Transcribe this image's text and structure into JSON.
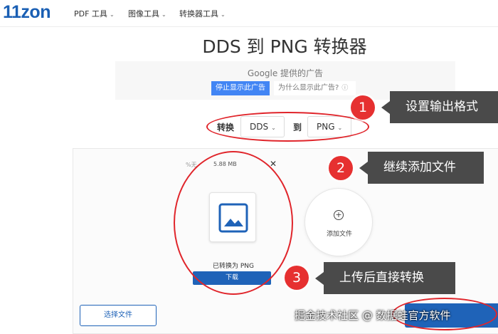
{
  "header": {
    "logo": "11zon",
    "nav": [
      {
        "label": "PDF 工具"
      },
      {
        "label": "图像工具"
      },
      {
        "label": "转换器工具"
      }
    ]
  },
  "page": {
    "title": "DDS 到 PNG 转换器"
  },
  "ad": {
    "google_text": "Google 提供的广告",
    "stop_button": "停止显示此广告",
    "why_link": "为什么显示此广告?",
    "info_icon": "info-icon"
  },
  "format": {
    "convert_label": "转换",
    "from_value": "DDS",
    "to_label": "到",
    "to_value": "PNG"
  },
  "file": {
    "percent": "%无",
    "size": "5.88 MB",
    "close_symbol": "✕",
    "status": "已转换为 PNG",
    "download_label": "下载",
    "thumbnail_icon": "image-icon"
  },
  "add_files": {
    "label": "添加文件",
    "icon": "plus-circle-icon"
  },
  "footer": {
    "choose_file": "选择文件"
  },
  "annotations": [
    {
      "number": "1",
      "text": "设置输出格式"
    },
    {
      "number": "2",
      "text": "继续添加文件"
    },
    {
      "number": "3",
      "text": "上传后直接转换"
    }
  ],
  "watermark": "掘金技术社区 @ 数据蛙官方软件",
  "colors": {
    "brand_blue": "#1f63b8",
    "annotation_red": "#e63030",
    "callout_gray": "#4a4a4a",
    "google_blue": "#4285f4"
  }
}
